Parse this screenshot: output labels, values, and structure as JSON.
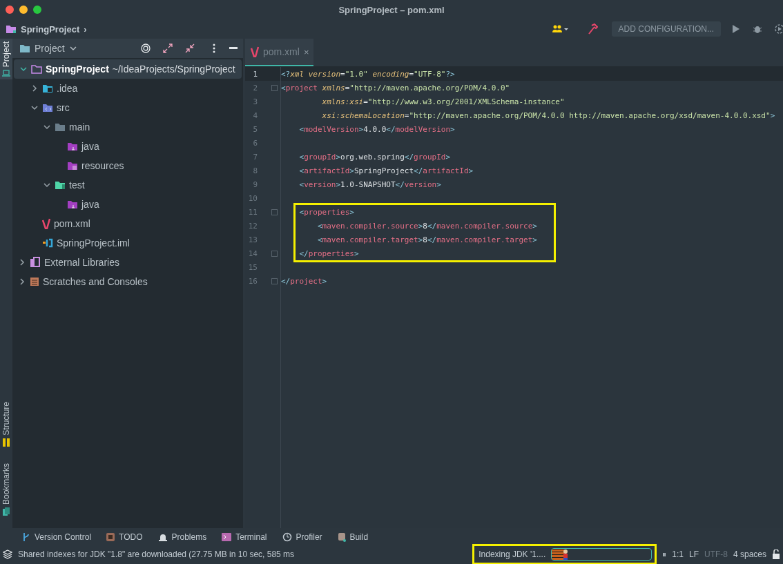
{
  "window": {
    "title": "SpringProject – pom.xml"
  },
  "navbar": {
    "breadcrumb": "SpringProject",
    "chevron": "›",
    "run_config": "ADD CONFIGURATION..."
  },
  "left_stripe": [
    {
      "label": "Project",
      "kind": "project",
      "selected": true
    },
    {
      "label": "Structure",
      "kind": "structure",
      "selected": false
    },
    {
      "label": "Bookmarks",
      "kind": "bookmarks",
      "selected": false
    }
  ],
  "project_panel": {
    "title": "Project",
    "tree": [
      {
        "label": "SpringProject",
        "path": "~/IdeaProjects/SpringProject",
        "kind": "module",
        "expanded": true,
        "selected": true,
        "children": [
          {
            "label": ".idea",
            "kind": "idea",
            "expanded": false,
            "selected": false
          },
          {
            "label": "src",
            "kind": "src",
            "expanded": true,
            "selected": false,
            "children": [
              {
                "label": "main",
                "kind": "folder",
                "expanded": true,
                "selected": false,
                "children": [
                  {
                    "label": "java",
                    "kind": "java",
                    "selected": false
                  },
                  {
                    "label": "resources",
                    "kind": "resources",
                    "selected": false
                  }
                ]
              },
              {
                "label": "test",
                "kind": "test",
                "expanded": true,
                "selected": false,
                "children": [
                  {
                    "label": "java",
                    "kind": "java",
                    "selected": false
                  }
                ]
              }
            ]
          },
          {
            "label": "pom.xml",
            "kind": "maven",
            "selected": false
          },
          {
            "label": "SpringProject.iml",
            "kind": "iml",
            "selected": false
          }
        ]
      },
      {
        "label": "External Libraries",
        "kind": "library",
        "expanded": false,
        "selected": false
      },
      {
        "label": "Scratches and Consoles",
        "kind": "scratch",
        "expanded": false,
        "selected": false
      }
    ]
  },
  "editor": {
    "tabs": [
      {
        "label": "pom.xml",
        "close": "×",
        "selected": true
      }
    ],
    "lines": [
      {
        "number": "1",
        "current": true,
        "fold": false,
        "boxed": false,
        "tokens": [
          {
            "kind": "bracket",
            "text": "<?"
          },
          {
            "kind": "attr",
            "text": "xml "
          },
          {
            "kind": "attr",
            "text": "version"
          },
          {
            "kind": "text",
            "text": "="
          },
          {
            "kind": "value",
            "text": "\"1.0\" "
          },
          {
            "kind": "attr",
            "text": "encoding"
          },
          {
            "kind": "text",
            "text": "="
          },
          {
            "kind": "value",
            "text": "\"UTF-8\""
          },
          {
            "kind": "bracket",
            "text": "?>"
          }
        ]
      },
      {
        "number": "2",
        "current": false,
        "fold": true,
        "boxed": false,
        "tokens": [
          {
            "kind": "bracket",
            "text": "<"
          },
          {
            "kind": "tag",
            "text": "project "
          },
          {
            "kind": "attr",
            "text": "xmlns"
          },
          {
            "kind": "text",
            "text": "="
          },
          {
            "kind": "value",
            "text": "\"http://maven.apache.org/POM/4.0.0\""
          }
        ]
      },
      {
        "number": "3",
        "current": false,
        "fold": false,
        "boxed": false,
        "tokens": [
          {
            "kind": "attr",
            "text": "         xmlns:xsi"
          },
          {
            "kind": "text",
            "text": "="
          },
          {
            "kind": "value",
            "text": "\"http://www.w3.org/2001/XMLSchema-instance\""
          }
        ]
      },
      {
        "number": "4",
        "current": false,
        "fold": false,
        "boxed": false,
        "tokens": [
          {
            "kind": "attr",
            "text": "         xsi:schemaLocation"
          },
          {
            "kind": "text",
            "text": "="
          },
          {
            "kind": "value",
            "text": "\"http://maven.apache.org/POM/4.0.0 http://maven.apache.org/xsd/maven-4.0.0.xsd\""
          },
          {
            "kind": "bracket",
            "text": ">"
          }
        ]
      },
      {
        "number": "5",
        "current": false,
        "fold": false,
        "boxed": false,
        "tokens": [
          {
            "kind": "bracket",
            "text": "    <"
          },
          {
            "kind": "tag",
            "text": "modelVersion"
          },
          {
            "kind": "bracket",
            "text": ">"
          },
          {
            "kind": "text",
            "text": "4.0.0"
          },
          {
            "kind": "bracket",
            "text": "</"
          },
          {
            "kind": "tag",
            "text": "modelVersion"
          },
          {
            "kind": "bracket",
            "text": ">"
          }
        ]
      },
      {
        "number": "6",
        "current": false,
        "fold": false,
        "boxed": false
      },
      {
        "number": "7",
        "current": false,
        "fold": false,
        "boxed": false,
        "tokens": [
          {
            "kind": "bracket",
            "text": "    <"
          },
          {
            "kind": "tag",
            "text": "groupId"
          },
          {
            "kind": "bracket",
            "text": ">"
          },
          {
            "kind": "text",
            "text": "org.web.spring"
          },
          {
            "kind": "bracket",
            "text": "</"
          },
          {
            "kind": "tag",
            "text": "groupId"
          },
          {
            "kind": "bracket",
            "text": ">"
          }
        ]
      },
      {
        "number": "8",
        "current": false,
        "fold": false,
        "boxed": false,
        "tokens": [
          {
            "kind": "bracket",
            "text": "    <"
          },
          {
            "kind": "tag",
            "text": "artifactId"
          },
          {
            "kind": "bracket",
            "text": ">"
          },
          {
            "kind": "text",
            "text": "SpringProject"
          },
          {
            "kind": "bracket",
            "text": "</"
          },
          {
            "kind": "tag",
            "text": "artifactId"
          },
          {
            "kind": "bracket",
            "text": ">"
          }
        ]
      },
      {
        "number": "9",
        "current": false,
        "fold": false,
        "boxed": false,
        "tokens": [
          {
            "kind": "bracket",
            "text": "    <"
          },
          {
            "kind": "tag",
            "text": "version"
          },
          {
            "kind": "bracket",
            "text": ">"
          },
          {
            "kind": "text",
            "text": "1.0-SNAPSHOT"
          },
          {
            "kind": "bracket",
            "text": "</"
          },
          {
            "kind": "tag",
            "text": "version"
          },
          {
            "kind": "bracket",
            "text": ">"
          }
        ]
      },
      {
        "number": "10",
        "current": false,
        "fold": false,
        "boxed": false
      },
      {
        "number": "11",
        "current": false,
        "fold": true,
        "boxed": true,
        "tokens": [
          {
            "kind": "bracket",
            "text": "    <"
          },
          {
            "kind": "tag",
            "text": "properties"
          },
          {
            "kind": "bracket",
            "text": ">"
          }
        ]
      },
      {
        "number": "12",
        "current": false,
        "fold": false,
        "boxed": true,
        "tokens": [
          {
            "kind": "bracket",
            "text": "        <"
          },
          {
            "kind": "tag",
            "text": "maven.compiler.source"
          },
          {
            "kind": "bracket",
            "text": ">"
          },
          {
            "kind": "text",
            "text": "8"
          },
          {
            "kind": "bracket",
            "text": "</"
          },
          {
            "kind": "tag",
            "text": "maven.compiler.source"
          },
          {
            "kind": "bracket",
            "text": ">"
          }
        ]
      },
      {
        "number": "13",
        "current": false,
        "fold": false,
        "boxed": true,
        "tokens": [
          {
            "kind": "bracket",
            "text": "        <"
          },
          {
            "kind": "tag",
            "text": "maven.compiler.target"
          },
          {
            "kind": "bracket",
            "text": ">"
          },
          {
            "kind": "text",
            "text": "8"
          },
          {
            "kind": "bracket",
            "text": "</"
          },
          {
            "kind": "tag",
            "text": "maven.compiler.target"
          },
          {
            "kind": "bracket",
            "text": ">"
          }
        ]
      },
      {
        "number": "14",
        "current": false,
        "fold": true,
        "boxed": true,
        "tokens": [
          {
            "kind": "bracket",
            "text": "    </"
          },
          {
            "kind": "tag",
            "text": "properties"
          },
          {
            "kind": "bracket",
            "text": ">"
          }
        ]
      },
      {
        "number": "15",
        "current": false,
        "fold": false,
        "boxed": false
      },
      {
        "number": "16",
        "current": false,
        "fold": true,
        "boxed": false,
        "tokens": [
          {
            "kind": "bracket",
            "text": "</"
          },
          {
            "kind": "tag",
            "text": "project"
          },
          {
            "kind": "bracket",
            "text": ">"
          }
        ]
      }
    ]
  },
  "tool_tabs": [
    {
      "label": "Version Control",
      "kind": "vcs"
    },
    {
      "label": "TODO",
      "kind": "todo"
    },
    {
      "label": "Problems",
      "kind": "problems"
    },
    {
      "label": "Terminal",
      "kind": "terminal"
    },
    {
      "label": "Profiler",
      "kind": "profiler"
    },
    {
      "label": "Build",
      "kind": "build"
    }
  ],
  "status_bar": {
    "message": "Shared indexes for JDK \"1.8\" are downloaded (27.75 MB in 10 sec, 585 ms",
    "task": "Indexing JDK '1....",
    "boxed": true,
    "progress": {
      "level": 0.12
    },
    "pause": "⏸",
    "items": [
      {
        "text": "1:1",
        "dim": false
      },
      {
        "text": "LF",
        "dim": false
      },
      {
        "text": "UTF-8",
        "dim": true
      },
      {
        "text": "4 spaces",
        "dim": false
      }
    ]
  }
}
